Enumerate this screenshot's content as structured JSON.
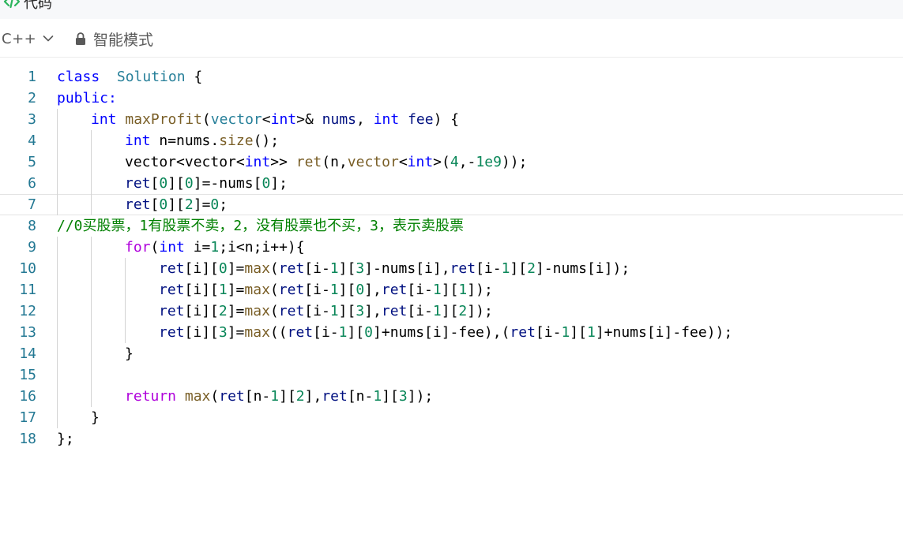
{
  "header": {
    "title": "代码",
    "icon": "code-icon"
  },
  "toolbar": {
    "language": "C++",
    "language_icon": "chevron-down-icon",
    "mode_icon": "lock-icon",
    "mode_label": "智能模式"
  },
  "editor": {
    "current_line": 7,
    "lines": [
      {
        "n": "1",
        "indent": 0,
        "tokens": [
          [
            "kw",
            "class"
          ],
          [
            "",
            "  "
          ],
          [
            "typ",
            "Solution"
          ],
          [
            "",
            " {"
          ]
        ]
      },
      {
        "n": "2",
        "indent": 0,
        "tokens": [
          [
            "kw",
            "public:"
          ]
        ]
      },
      {
        "n": "3",
        "indent": 1,
        "tokens": [
          [
            "kw",
            "int"
          ],
          [
            "",
            " "
          ],
          [
            "fn",
            "maxProfit"
          ],
          [
            "",
            "("
          ],
          [
            "typ",
            "vector"
          ],
          [
            "",
            "<"
          ],
          [
            "kw",
            "int"
          ],
          [
            "",
            ">& "
          ],
          [
            "var",
            "nums"
          ],
          [
            "",
            ", "
          ],
          [
            "kw",
            "int"
          ],
          [
            "",
            " "
          ],
          [
            "var",
            "fee"
          ],
          [
            "",
            ") {"
          ]
        ]
      },
      {
        "n": "4",
        "indent": 2,
        "tokens": [
          [
            "kw",
            "int"
          ],
          [
            "",
            " n=nums."
          ],
          [
            "fn",
            "size"
          ],
          [
            "",
            "();"
          ]
        ]
      },
      {
        "n": "5",
        "indent": 2,
        "tokens": [
          [
            "",
            "vector<vector<"
          ],
          [
            "kw",
            "int"
          ],
          [
            "",
            ">> "
          ],
          [
            "fn",
            "ret"
          ],
          [
            "",
            "(n,"
          ],
          [
            "fn",
            "vector"
          ],
          [
            "",
            "<"
          ],
          [
            "kw",
            "int"
          ],
          [
            "",
            ">("
          ],
          [
            "num",
            "4"
          ],
          [
            "",
            ",-"
          ],
          [
            "num",
            "1e9"
          ],
          [
            "",
            "));"
          ]
        ]
      },
      {
        "n": "6",
        "indent": 2,
        "tokens": [
          [
            "var",
            "ret"
          ],
          [
            "",
            "["
          ],
          [
            "num",
            "0"
          ],
          [
            "",
            "]["
          ],
          [
            "num",
            "0"
          ],
          [
            "",
            "]=-nums["
          ],
          [
            "num",
            "0"
          ],
          [
            "",
            "];"
          ]
        ]
      },
      {
        "n": "7",
        "indent": 2,
        "tokens": [
          [
            "var",
            "ret"
          ],
          [
            "",
            "["
          ],
          [
            "num",
            "0"
          ],
          [
            "",
            "]["
          ],
          [
            "num",
            "2"
          ],
          [
            "",
            "]="
          ],
          [
            "num",
            "0"
          ],
          [
            "",
            ";"
          ]
        ]
      },
      {
        "n": "8",
        "indent": 0,
        "tokens": [
          [
            "cmt",
            "//0买股票，1有股票不卖，2，没有股票也不买，3，表示卖股票"
          ]
        ]
      },
      {
        "n": "9",
        "indent": 2,
        "tokens": [
          [
            "ctl",
            "for"
          ],
          [
            "",
            "("
          ],
          [
            "kw",
            "int"
          ],
          [
            "",
            " i="
          ],
          [
            "num",
            "1"
          ],
          [
            "",
            ";i<n;i++){"
          ]
        ]
      },
      {
        "n": "10",
        "indent": 3,
        "tokens": [
          [
            "var",
            "ret"
          ],
          [
            "",
            "[i]["
          ],
          [
            "num",
            "0"
          ],
          [
            "",
            "]="
          ],
          [
            "fn",
            "max"
          ],
          [
            "",
            "("
          ],
          [
            "var",
            "ret"
          ],
          [
            "",
            "[i-"
          ],
          [
            "num",
            "1"
          ],
          [
            "",
            "]["
          ],
          [
            "num",
            "3"
          ],
          [
            "",
            "]-nums[i],"
          ],
          [
            "var",
            "ret"
          ],
          [
            "",
            "[i-"
          ],
          [
            "num",
            "1"
          ],
          [
            "",
            "]["
          ],
          [
            "num",
            "2"
          ],
          [
            "",
            "]-nums[i]);"
          ]
        ]
      },
      {
        "n": "11",
        "indent": 3,
        "tokens": [
          [
            "var",
            "ret"
          ],
          [
            "",
            "[i]["
          ],
          [
            "num",
            "1"
          ],
          [
            "",
            "]="
          ],
          [
            "fn",
            "max"
          ],
          [
            "",
            "("
          ],
          [
            "var",
            "ret"
          ],
          [
            "",
            "[i-"
          ],
          [
            "num",
            "1"
          ],
          [
            "",
            "]["
          ],
          [
            "num",
            "0"
          ],
          [
            "",
            "],"
          ],
          [
            "var",
            "ret"
          ],
          [
            "",
            "[i-"
          ],
          [
            "num",
            "1"
          ],
          [
            "",
            "]["
          ],
          [
            "num",
            "1"
          ],
          [
            "",
            "]);"
          ]
        ]
      },
      {
        "n": "12",
        "indent": 3,
        "tokens": [
          [
            "var",
            "ret"
          ],
          [
            "",
            "[i]["
          ],
          [
            "num",
            "2"
          ],
          [
            "",
            "]="
          ],
          [
            "fn",
            "max"
          ],
          [
            "",
            "("
          ],
          [
            "var",
            "ret"
          ],
          [
            "",
            "[i-"
          ],
          [
            "num",
            "1"
          ],
          [
            "",
            "]["
          ],
          [
            "num",
            "3"
          ],
          [
            "",
            "],"
          ],
          [
            "var",
            "ret"
          ],
          [
            "",
            "[i-"
          ],
          [
            "num",
            "1"
          ],
          [
            "",
            "]["
          ],
          [
            "num",
            "2"
          ],
          [
            "",
            "]);"
          ]
        ]
      },
      {
        "n": "13",
        "indent": 3,
        "tokens": [
          [
            "var",
            "ret"
          ],
          [
            "",
            "[i]["
          ],
          [
            "num",
            "3"
          ],
          [
            "",
            "]="
          ],
          [
            "fn",
            "max"
          ],
          [
            "",
            "(("
          ],
          [
            "var",
            "ret"
          ],
          [
            "",
            "[i-"
          ],
          [
            "num",
            "1"
          ],
          [
            "",
            "]["
          ],
          [
            "num",
            "0"
          ],
          [
            "",
            "]+nums[i]-fee),("
          ],
          [
            "var",
            "ret"
          ],
          [
            "",
            "[i-"
          ],
          [
            "num",
            "1"
          ],
          [
            "",
            "]["
          ],
          [
            "num",
            "1"
          ],
          [
            "",
            "]+nums[i]-fee));"
          ]
        ]
      },
      {
        "n": "14",
        "indent": 2,
        "tokens": [
          [
            "",
            "}"
          ]
        ]
      },
      {
        "n": "15",
        "indent": 2,
        "tokens": []
      },
      {
        "n": "16",
        "indent": 2,
        "tokens": [
          [
            "ctl",
            "return"
          ],
          [
            "",
            " "
          ],
          [
            "fn",
            "max"
          ],
          [
            "",
            "("
          ],
          [
            "var",
            "ret"
          ],
          [
            "",
            "[n-"
          ],
          [
            "num",
            "1"
          ],
          [
            "",
            "]["
          ],
          [
            "num",
            "2"
          ],
          [
            "",
            "],"
          ],
          [
            "var",
            "ret"
          ],
          [
            "",
            "[n-"
          ],
          [
            "num",
            "1"
          ],
          [
            "",
            "]["
          ],
          [
            "num",
            "3"
          ],
          [
            "",
            "]);"
          ]
        ]
      },
      {
        "n": "17",
        "indent": 1,
        "tokens": [
          [
            "",
            "}"
          ]
        ]
      },
      {
        "n": "18",
        "indent": 0,
        "tokens": [
          [
            "",
            "};"
          ]
        ]
      }
    ]
  },
  "colors": {
    "line_number": "#237893",
    "keyword": "#0000ff",
    "function": "#795e26",
    "type": "#267f99",
    "variable": "#001080",
    "number": "#098658",
    "control": "#af00db",
    "comment": "#008000",
    "accent_green": "#2db55d"
  }
}
